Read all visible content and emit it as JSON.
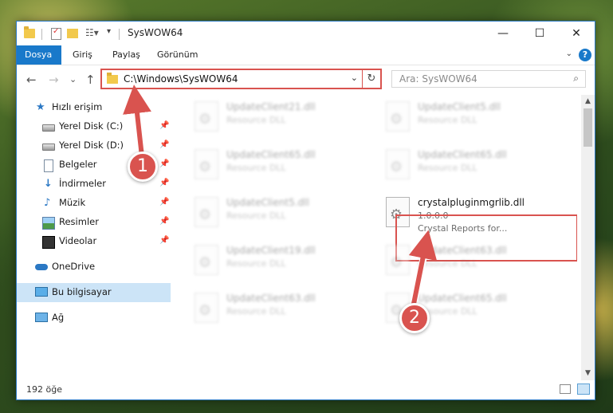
{
  "window": {
    "title": "SysWOW64",
    "controls": {
      "minimize": "—",
      "maximize": "☐",
      "close": "✕"
    }
  },
  "ribbon": {
    "tabs": [
      {
        "label": "Dosya",
        "active": true
      },
      {
        "label": "Giriş"
      },
      {
        "label": "Paylaş"
      },
      {
        "label": "Görünüm"
      }
    ],
    "help": "?"
  },
  "address": {
    "path": "C:\\Windows\\SysWOW64",
    "refresh_icon": "↻",
    "chevron_icon": "⌄"
  },
  "search": {
    "placeholder": "Ara: SysWOW64",
    "icon": "⌕"
  },
  "nav_buttons": {
    "back": "←",
    "forward": "→",
    "recent": "⌄",
    "up": "↑"
  },
  "sidebar": {
    "items": [
      {
        "label": "Hızlı erişim",
        "icon": "star-icon",
        "pinned": false
      },
      {
        "label": "Yerel Disk (C:)",
        "icon": "drive-icon",
        "pinned": true
      },
      {
        "label": "Yerel Disk (D:)",
        "icon": "drive-icon",
        "pinned": true
      },
      {
        "label": "Belgeler",
        "icon": "documents-icon",
        "pinned": true
      },
      {
        "label": "İndirmeler",
        "icon": "downloads-icon",
        "pinned": true
      },
      {
        "label": "Müzik",
        "icon": "music-icon",
        "pinned": true
      },
      {
        "label": "Resimler",
        "icon": "pictures-icon",
        "pinned": true
      },
      {
        "label": "Videolar",
        "icon": "videos-icon",
        "pinned": true
      },
      {
        "label": "OneDrive",
        "icon": "cloud-icon"
      },
      {
        "label": "Bu bilgisayar",
        "icon": "computer-icon",
        "selected": true
      },
      {
        "label": "Ağ",
        "icon": "network-icon"
      }
    ],
    "pin_icon": "📌"
  },
  "files": [
    {
      "name": "UpdateClient21.dll",
      "type": "Resource DLL"
    },
    {
      "name": "UpdateClient5.dll",
      "type": "Resource DLL"
    },
    {
      "name": "UpdateClient65.dll",
      "type": "Resource DLL"
    },
    {
      "name": "UpdateClient65.dll",
      "type": "Resource DLL"
    },
    {
      "name": "UpdateClient5.dll",
      "type": "Resource DLL"
    },
    {
      "name": "crystalpluginmgrlib.dll",
      "version": "1.0.0.0",
      "type": "Crystal Reports for...",
      "highlighted": true
    },
    {
      "name": "UpdateClient19.dll",
      "type": "Resource DLL"
    },
    {
      "name": "UpdateClient63.dll",
      "type": "Resource DLL"
    },
    {
      "name": "UpdateClient63.dll",
      "type": "Resource DLL"
    },
    {
      "name": "UpdateClient65.dll",
      "type": "Resource DLL"
    }
  ],
  "status": {
    "item_count": "192 öğe"
  },
  "annotations": [
    {
      "number": "1"
    },
    {
      "number": "2"
    }
  ],
  "colors": {
    "accent": "#1979ca",
    "highlight": "#d9534f",
    "selected": "#cce4f7"
  }
}
